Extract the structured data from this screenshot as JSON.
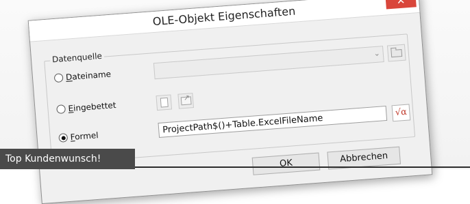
{
  "window": {
    "title": "OLE-Objekt Eigenschaften",
    "close_glyph": "✕"
  },
  "group": {
    "legend": "Datenquelle"
  },
  "options": [
    {
      "accel": "D",
      "rest": "ateiname",
      "checked": false
    },
    {
      "accel": "E",
      "rest": "ingebettet",
      "checked": false
    },
    {
      "accel": "F",
      "rest": "ormel",
      "checked": true
    }
  ],
  "file_combo": {
    "value": "",
    "arrow_glyph": "⌄"
  },
  "formula": {
    "value": "ProjectPath$()+Table.ExcelFileName",
    "button_glyph": "√α"
  },
  "buttons": {
    "ok": "OK",
    "cancel": "Abbrechen"
  },
  "banner": {
    "text": "Top Kundenwunsch!"
  },
  "colors": {
    "close_button": "#d9463b",
    "formula_icon": "#c0392b",
    "banner_bg": "#4a4a4a"
  }
}
